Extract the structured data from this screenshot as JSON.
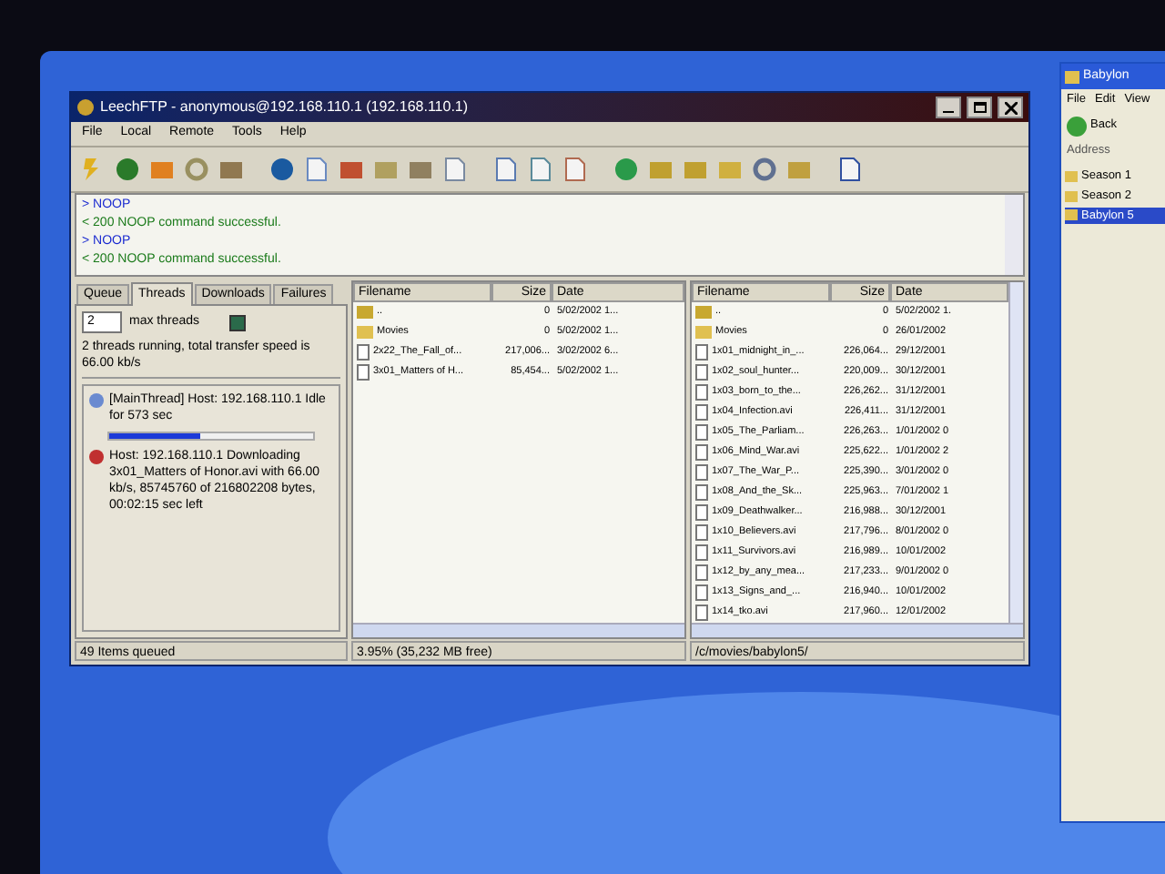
{
  "window": {
    "title": "LeechFTP - anonymous@192.168.110.1 (192.168.110.1)"
  },
  "menu": [
    "File",
    "Local",
    "Remote",
    "Tools",
    "Help"
  ],
  "log": [
    {
      "kind": "command",
      "text": "> NOOP"
    },
    {
      "kind": "reply",
      "text": "< 200 NOOP command successful."
    },
    {
      "kind": "command",
      "text": "> NOOP"
    },
    {
      "kind": "reply",
      "text": "< 200 NOOP command successful."
    }
  ],
  "queue_panel": {
    "tabs": [
      {
        "label": "Queue",
        "selected": false
      },
      {
        "label": "Threads",
        "selected": true
      },
      {
        "label": "Downloads",
        "selected": false
      },
      {
        "label": "Failures",
        "selected": false
      }
    ],
    "max_threads_value": "2",
    "max_threads_label": "max threads",
    "summary": "2 threads running, total transfer speed is 66.00 kb/s",
    "threads": [
      {
        "kind": "idle",
        "text": "[MainThread] Host: 192.168.110.1 Idle for 573 sec",
        "level": 0.45
      },
      {
        "kind": "download",
        "text": "Host: 192.168.110.1 Downloading 3x01_Matters of Honor.avi with 66.00 kb/s, 85745760 of 216802208 bytes, 00:02:15 sec left"
      }
    ],
    "status": "49 Items queued"
  },
  "local_pane": {
    "columns": [
      "Filename",
      "Size",
      "Date"
    ],
    "rows": [
      {
        "kind": "up",
        "name": "..",
        "size": "0",
        "date": "5/02/2002 1..."
      },
      {
        "kind": "folder",
        "name": "Movies",
        "size": "0",
        "date": "5/02/2002 1..."
      },
      {
        "kind": "file",
        "name": "2x22_The_Fall_of...",
        "size": "217,006...",
        "date": "3/02/2002 6..."
      },
      {
        "kind": "file",
        "name": "3x01_Matters of H...",
        "size": "85,454...",
        "date": "5/02/2002 1..."
      }
    ],
    "status": "3.95% (35,232 MB free)"
  },
  "remote_pane": {
    "columns": [
      "Filename",
      "Size",
      "Date"
    ],
    "rows": [
      {
        "kind": "up",
        "name": "..",
        "size": "0",
        "date": "5/02/2002 1."
      },
      {
        "kind": "folder",
        "name": "Movies",
        "size": "0",
        "date": "26/01/2002"
      },
      {
        "kind": "file",
        "name": "1x01_midnight_in_...",
        "size": "226,064...",
        "date": "29/12/2001"
      },
      {
        "kind": "file",
        "name": "1x02_soul_hunter...",
        "size": "220,009...",
        "date": "30/12/2001"
      },
      {
        "kind": "file",
        "name": "1x03_born_to_the...",
        "size": "226,262...",
        "date": "31/12/2001"
      },
      {
        "kind": "file",
        "name": "1x04_Infection.avi",
        "size": "226,411...",
        "date": "31/12/2001"
      },
      {
        "kind": "file",
        "name": "1x05_The_Parliam...",
        "size": "226,263...",
        "date": "1/01/2002 0"
      },
      {
        "kind": "file",
        "name": "1x06_Mind_War.avi",
        "size": "225,622...",
        "date": "1/01/2002 2"
      },
      {
        "kind": "file",
        "name": "1x07_The_War_P...",
        "size": "225,390...",
        "date": "3/01/2002 0"
      },
      {
        "kind": "file",
        "name": "1x08_And_the_Sk...",
        "size": "225,963...",
        "date": "7/01/2002 1"
      },
      {
        "kind": "file",
        "name": "1x09_Deathwalker...",
        "size": "216,988...",
        "date": "30/12/2001"
      },
      {
        "kind": "file",
        "name": "1x10_Believers.avi",
        "size": "217,796...",
        "date": "8/01/2002 0"
      },
      {
        "kind": "file",
        "name": "1x11_Survivors.avi",
        "size": "216,989...",
        "date": "10/01/2002"
      },
      {
        "kind": "file",
        "name": "1x12_by_any_mea...",
        "size": "217,233...",
        "date": "9/01/2002 0"
      },
      {
        "kind": "file",
        "name": "1x13_Signs_and_...",
        "size": "216,940...",
        "date": "10/01/2002"
      },
      {
        "kind": "file",
        "name": "1x14_tko.avi",
        "size": "217,960...",
        "date": "12/01/2002"
      }
    ],
    "status": "/c/movies/babylon5/"
  },
  "side_window": {
    "title": "Babylon",
    "menu": [
      "File",
      "Edit",
      "View"
    ],
    "back": "Back",
    "address": "Address",
    "items": [
      {
        "label": "Season 1",
        "selected": false
      },
      {
        "label": "Season 2",
        "selected": false
      },
      {
        "label": "Babylon 5",
        "selected": true
      }
    ]
  }
}
